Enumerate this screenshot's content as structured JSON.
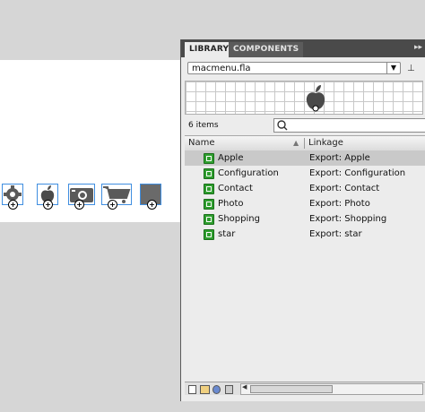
{
  "stage": {
    "icons": [
      {
        "name": "settings"
      },
      {
        "name": "apple"
      },
      {
        "name": "photo"
      },
      {
        "name": "shopping"
      },
      {
        "name": "star"
      }
    ]
  },
  "panel": {
    "tabs": [
      {
        "label": "LIBRARY",
        "active": true
      },
      {
        "label": "COMPONENTS",
        "active": false
      }
    ],
    "document": "macmenu.fla",
    "item_count": "6 items",
    "columns": {
      "name": "Name",
      "linkage": "Linkage"
    },
    "items": [
      {
        "name": "Apple",
        "linkage": "Export: Apple",
        "selected": true
      },
      {
        "name": "Configuration",
        "linkage": "Export: Configuration",
        "selected": false
      },
      {
        "name": "Contact",
        "linkage": "Export: Contact",
        "selected": false
      },
      {
        "name": "Photo",
        "linkage": "Export: Photo",
        "selected": false
      },
      {
        "name": "Shopping",
        "linkage": "Export: Shopping",
        "selected": false
      },
      {
        "name": "star",
        "linkage": "Export: star",
        "selected": false
      }
    ]
  },
  "colors": {
    "symbol_green": "#2f9e2f",
    "selection": "#c9c9c9",
    "tab_bar": "#4a4a4a"
  }
}
